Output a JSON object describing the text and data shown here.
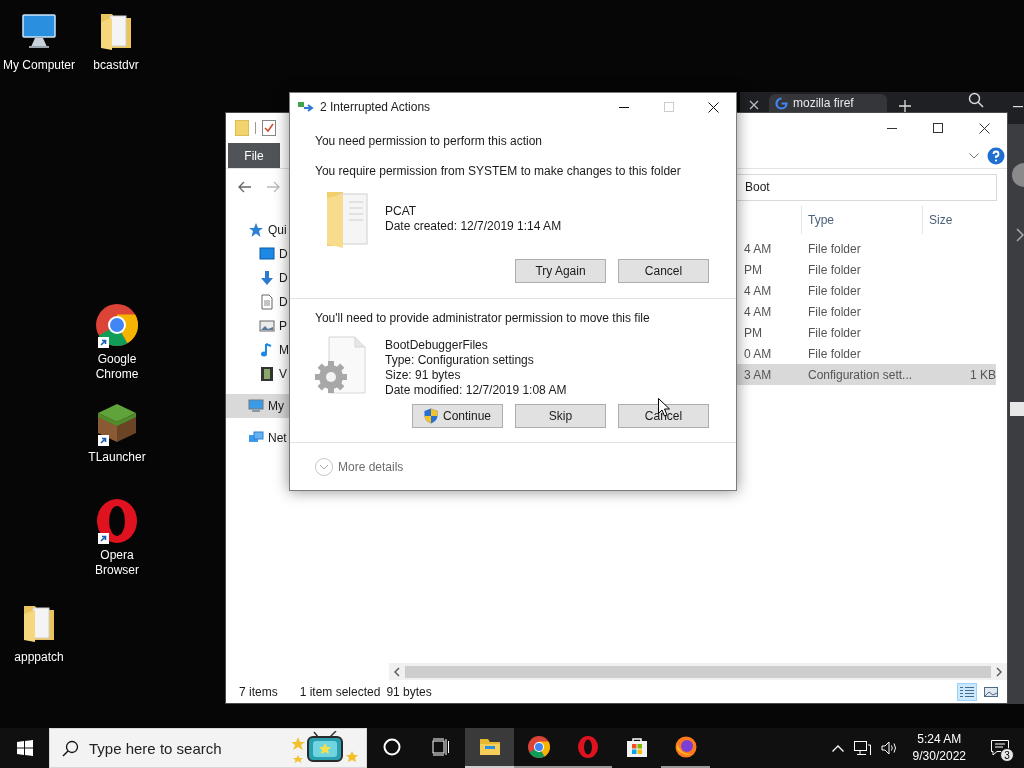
{
  "desktop_icons": [
    {
      "label": "My Computer",
      "kind": "computer",
      "shortcut": false
    },
    {
      "label": "bcastdvr",
      "kind": "folder",
      "shortcut": false
    },
    {
      "label": "Google Chrome",
      "kind": "chrome",
      "shortcut": true
    },
    {
      "label": "TLauncher",
      "kind": "tlauncher",
      "shortcut": true
    },
    {
      "label": "Opera Browser",
      "kind": "opera",
      "shortcut": true
    },
    {
      "label": "apppatch",
      "kind": "folder",
      "shortcut": false
    }
  ],
  "browser": {
    "tabs": [
      {
        "label": "mozilla firef",
        "selected": true
      }
    ]
  },
  "explorer": {
    "file_tab": "File",
    "address": "Boot",
    "nav": [
      {
        "label": "Qui",
        "kind": "star",
        "selected": false,
        "children": [
          {
            "label": "D",
            "kind": "desktop",
            "selected": false
          },
          {
            "label": "D",
            "kind": "download",
            "selected": false
          },
          {
            "label": "D",
            "kind": "document",
            "selected": false
          },
          {
            "label": "P",
            "kind": "picture",
            "selected": false
          },
          {
            "label": "M",
            "kind": "music",
            "selected": false
          },
          {
            "label": "V",
            "kind": "video",
            "selected": false
          }
        ]
      },
      {
        "label": "My",
        "kind": "pc",
        "selected": true
      },
      {
        "label": "Net",
        "kind": "network",
        "selected": false
      }
    ],
    "columns": [
      "Type",
      "Size"
    ],
    "rows": [
      {
        "column_1": "4 AM",
        "type": "File folder",
        "selected": false
      },
      {
        "column_1": "PM",
        "type": "File folder",
        "selected": false
      },
      {
        "column_1": "4 AM",
        "type": "File folder",
        "selected": false
      },
      {
        "column_1": "4 AM",
        "type": "File folder",
        "selected": false
      },
      {
        "column_1": "PM",
        "type": "File folder",
        "selected": false
      },
      {
        "column_1": "0 AM",
        "type": "File folder",
        "selected": false
      },
      {
        "column_1": "3 AM",
        "type": "Configuration sett...",
        "size": "1 KB",
        "selected": true
      }
    ],
    "status": {
      "count": "7 items",
      "selection": "1 item selected",
      "size": "91 bytes"
    }
  },
  "dialog": {
    "title": "2 Interrupted Actions",
    "sections": [
      {
        "heading": "You need permission to perform this action",
        "message": "You require permission from SYSTEM to make changes to this folder",
        "item": {
          "kind": "folder",
          "lines": [
            "PCAT",
            "Date created: 12/7/2019 1:14 AM"
          ]
        },
        "buttons": [
          {
            "label": "Try Again",
            "kind": "plain"
          },
          {
            "label": "Cancel",
            "kind": "plain"
          }
        ]
      },
      {
        "message": "You'll need to provide administrator permission to move this file",
        "item": {
          "kind": "settings-file",
          "lines": [
            "BootDebuggerFiles",
            "Type: Configuration settings",
            "Size: 91 bytes",
            "Date modified: 12/7/2019 1:08 AM"
          ]
        },
        "buttons": [
          {
            "label": "Continue",
            "kind": "shield"
          },
          {
            "label": "Skip",
            "kind": "plain"
          },
          {
            "label": "Cancel",
            "kind": "plain"
          }
        ]
      }
    ],
    "more_details": {
      "label": "More details",
      "expanded": false
    }
  },
  "taskbar": {
    "search_placeholder": "Type here to search",
    "apps": [
      {
        "kind": "cortana",
        "running": false,
        "active": false
      },
      {
        "kind": "taskview",
        "running": false,
        "active": false
      },
      {
        "kind": "explorer",
        "running": true,
        "active": true
      },
      {
        "kind": "chrome",
        "running": true,
        "active": false
      },
      {
        "kind": "opera",
        "running": true,
        "active": false
      },
      {
        "kind": "store",
        "running": false,
        "active": false
      },
      {
        "kind": "firefox",
        "running": true,
        "active": false
      }
    ],
    "clock": {
      "time": "5:24 AM",
      "date": "9/30/2022"
    },
    "notifications": "3"
  }
}
